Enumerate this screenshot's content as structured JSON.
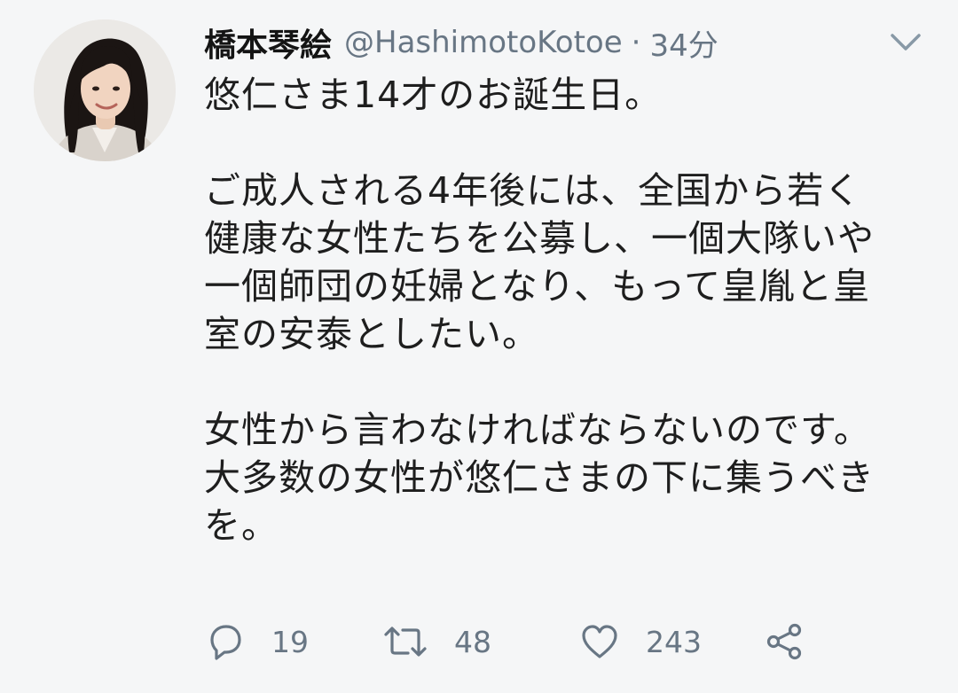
{
  "tweet": {
    "author": {
      "display_name": "橋本琴絵",
      "handle": "@HashimotoKotoe"
    },
    "separator": "·",
    "time": "34分",
    "body_lines": [
      "悠仁さま14才のお誕生日。",
      "",
      "ご成人される4年後には、全国から若く",
      "健康な女性たちを公募し、一個大隊いや",
      "一個師団の妊婦となり、もって皇胤と皇",
      "室の安泰としたい。",
      "",
      "女性から言わなければならないのです。",
      "大多数の女性が悠仁さまの下に集うべき",
      "を。"
    ],
    "actions": {
      "reply_count": "19",
      "retweet_count": "48",
      "like_count": "243"
    }
  },
  "icons": {
    "avatar": "profile-photo",
    "caret": "chevron-down-icon",
    "reply": "reply-icon",
    "retweet": "retweet-icon",
    "like": "heart-icon",
    "share": "share-icon"
  },
  "colors": {
    "background": "#f5f6f7",
    "text_primary": "#1e1e1e",
    "text_secondary": "#687684"
  }
}
